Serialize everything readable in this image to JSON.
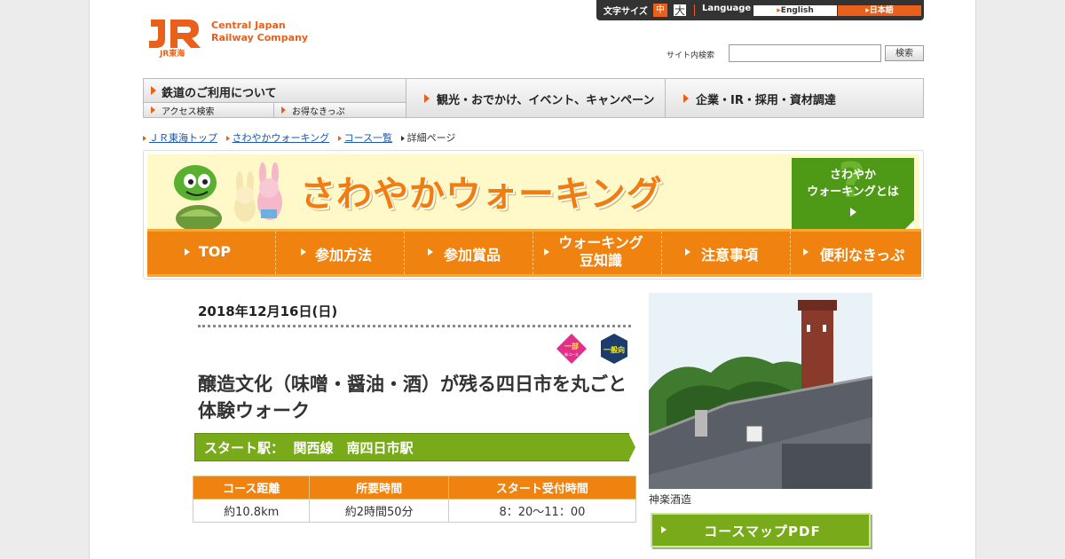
{
  "header": {
    "logo_mark": "JR",
    "logo_sub": "JR東海",
    "company_line1": "Central Japan",
    "company_line2": "Railway Company",
    "font_size_label": "文字サイズ",
    "font_size_mid": "中",
    "font_size_large": "大",
    "language_label": "Language",
    "lang_en": "English",
    "lang_ja": "日本語",
    "search_label": "サイト内検索",
    "search_value": "",
    "search_button": "検索"
  },
  "global_nav": {
    "rail": "鉄道のご利用について",
    "access": "アクセス検索",
    "ticket": "お得なきっぷ",
    "tour": "観光・おでかけ、イベント、キャンペーン",
    "corp": "企業・IR・採用・資材調達"
  },
  "breadcrumb": [
    "ＪＲ東海トップ",
    "さわやかウォーキング",
    "コース一覧",
    "詳細ページ"
  ],
  "banner": {
    "title": "さわやかウォーキング",
    "about_line1": "さわやか",
    "about_line2": "ウォーキングとは",
    "about_q": "?",
    "nav": [
      {
        "line1": "TOP",
        "line2": ""
      },
      {
        "line1": "参加方法",
        "line2": ""
      },
      {
        "line1": "参加賞品",
        "line2": ""
      },
      {
        "line1": "ウォーキング",
        "line2": "豆知識"
      },
      {
        "line1": "注意事項",
        "line2": ""
      },
      {
        "line1": "便利なきっぷ",
        "line2": ""
      }
    ]
  },
  "course": {
    "date": "2018年12月16日(日)",
    "badge_part_line1": "一部",
    "badge_part_line2": "新コース",
    "badge_general": "一般向",
    "title": "醸造文化（味噌・醤油・酒）が残る四日市を丸ごと体験ウォーク",
    "start_station": "スタート駅：  関西線　南四日市駅",
    "table_headers": [
      "コース距離",
      "所要時間",
      "スタート受付時間"
    ],
    "table_values": [
      "約10.8km",
      "約2時間50分",
      "8：20～11：00"
    ],
    "photo_caption": "神楽酒造",
    "pdf_button": "コースマップPDF"
  },
  "colors": {
    "jr_orange": "#e8601a",
    "banner_orange": "#f0820f",
    "walk_green": "#78aa1a",
    "badge_magenta": "#e0308c",
    "badge_navy": "#1c3c6e"
  }
}
